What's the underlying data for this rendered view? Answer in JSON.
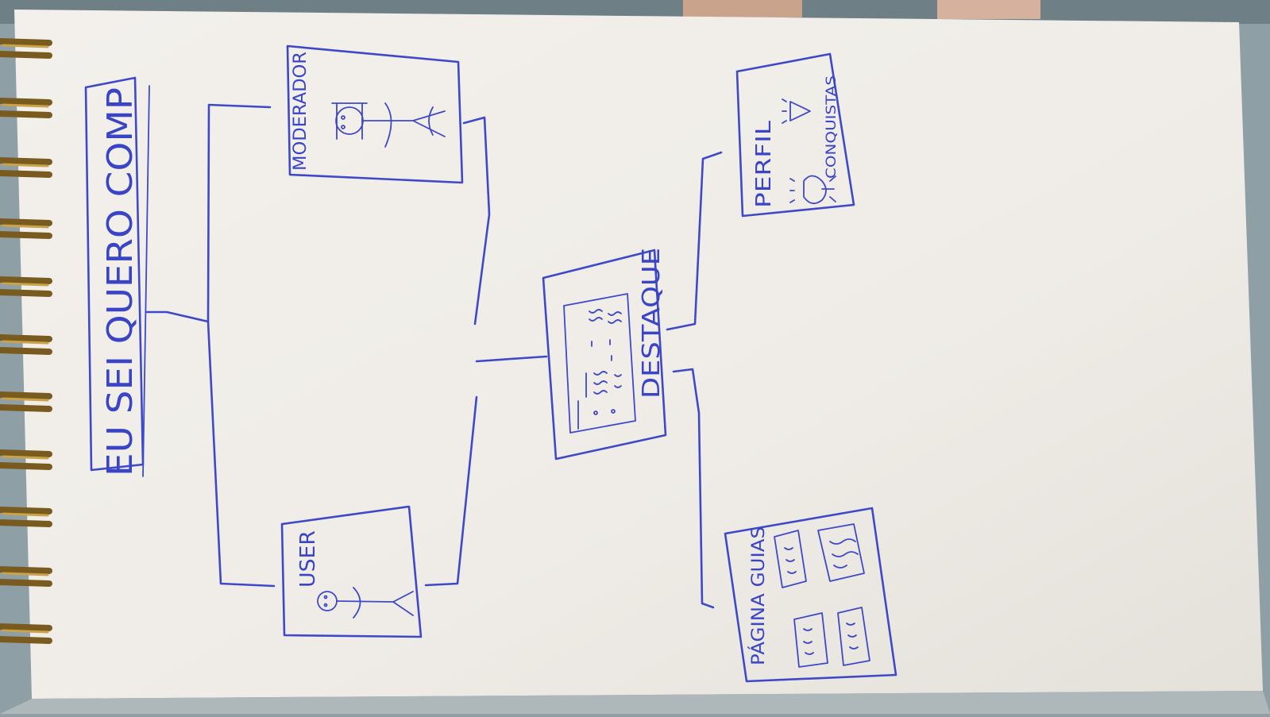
{
  "diagram": {
    "title": "EU SEI QUERO COMP",
    "nodes": {
      "moderador": {
        "label": "MODERADOR"
      },
      "user": {
        "label": "USER"
      },
      "destaque": {
        "label": "DESTAQUE"
      },
      "perfil": {
        "label": "PERFIL",
        "sublabel": "CONQUISTAS"
      },
      "pagina_guias": {
        "label": "PÁGINA GUIAS"
      }
    }
  },
  "colors": {
    "ink": "#3f49c8",
    "paper": "#f1eee9",
    "background": "#8f9fa6",
    "spiral": "#b08a3a"
  }
}
